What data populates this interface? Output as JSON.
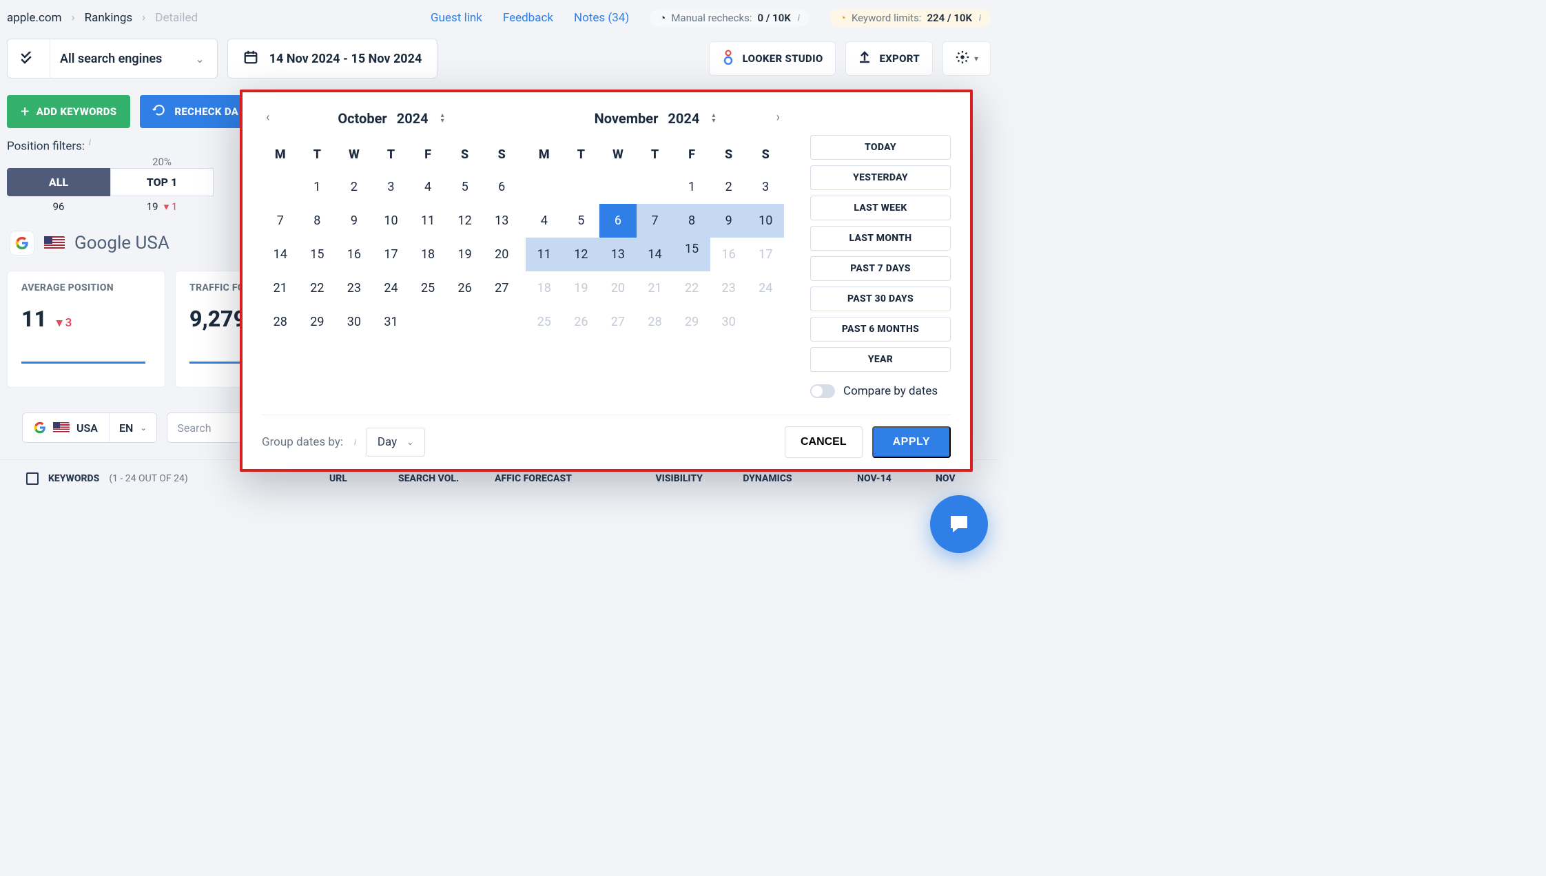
{
  "breadcrumb": {
    "domain": "apple.com",
    "section": "Rankings",
    "sub": "Detailed"
  },
  "topbar": {
    "guest_link": "Guest link",
    "feedback": "Feedback",
    "notes": "Notes (34)",
    "rechecks_label": "Manual rechecks:",
    "rechecks_value": "0 / 10K",
    "limits_label": "Keyword limits:",
    "limits_value": "224 / 10K"
  },
  "engine_select": {
    "label": "All search engines"
  },
  "date_range": {
    "label": "14 Nov 2024 - 15 Nov 2024"
  },
  "right_buttons": {
    "looker": "LOOKER STUDIO",
    "export": "EXPORT"
  },
  "actions": {
    "add_kw": "ADD KEYWORDS",
    "recheck": "RECHECK DA"
  },
  "filters": {
    "label": "Position filters:",
    "tabs": [
      {
        "pct": "",
        "main": "ALL",
        "count": "96",
        "delta": ""
      },
      {
        "pct": "20%",
        "main": "TOP 1",
        "count": "19",
        "delta": "1"
      }
    ]
  },
  "se": {
    "name": "Google USA"
  },
  "metrics": {
    "avg_pos": {
      "title": "AVERAGE POSITION",
      "value": "11",
      "delta": "3"
    },
    "traffic": {
      "title": "TRAFFIC FC",
      "value": "9,279,"
    }
  },
  "bottom": {
    "country": "USA",
    "lang": "EN",
    "search_placeholder": "Search"
  },
  "table": {
    "header_kw": "KEYWORDS",
    "header_kw_count": "(1 - 24 OUT OF 24)",
    "url": "URL",
    "searchvol": "SEARCH VOL.",
    "traffic_fc": "AFFIC FORECAST",
    "visibility": "VISIBILITY",
    "dynamics": "DYNAMICS",
    "nov14": "NOV-14",
    "nov": "NOV"
  },
  "datepicker": {
    "month1": {
      "name": "October",
      "year": "2024"
    },
    "month2": {
      "name": "November",
      "year": "2024"
    },
    "dows": [
      "M",
      "T",
      "W",
      "T",
      "F",
      "S",
      "S"
    ],
    "oct_days": [
      [
        "",
        "",
        1,
        2,
        3,
        4,
        5,
        6
      ],
      [
        7,
        8,
        9,
        10,
        11,
        12,
        13
      ],
      [
        14,
        15,
        16,
        17,
        18,
        19,
        20
      ],
      [
        21,
        22,
        23,
        24,
        25,
        26,
        27
      ],
      [
        28,
        29,
        30,
        31
      ]
    ],
    "presets": [
      "TODAY",
      "YESTERDAY",
      "LAST WEEK",
      "LAST MONTH",
      "PAST 7 DAYS",
      "PAST 30 DAYS",
      "PAST 6 MONTHS",
      "YEAR"
    ],
    "compare": "Compare by dates",
    "group_label": "Group dates by:",
    "group_value": "Day",
    "cancel": "CANCEL",
    "apply": "APPLY"
  }
}
